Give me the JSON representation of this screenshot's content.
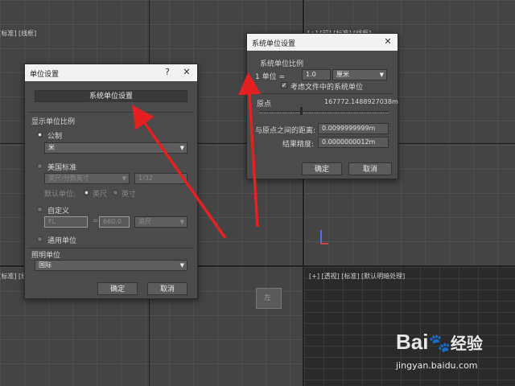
{
  "viewports": {
    "top_left_label": "[+] [顶] [标准] [线框]",
    "top_right_label": "[+] [前] [标准] [线框]",
    "bottom_left_label": "[+] [左] [标准] [线框]",
    "bottom_right_label": "[+] [透视] [标准] [默认明暗处理]"
  },
  "unit_setup": {
    "title": "单位设置",
    "help_glyph": "?",
    "close_glyph": "✕",
    "system_setup_button": "系统单位设置",
    "display_scale_label": "显示单位比例",
    "metric_label": "公制",
    "metric_value": "米",
    "us_standard_label": "美国标准",
    "us_standard_value": "英尺/分数英寸",
    "fraction_value": "1/32",
    "default_unit_label": "默认单位:",
    "feet_label": "英尺",
    "inch_label": "英寸",
    "custom_label": "自定义",
    "custom_name": "FL",
    "equals": "=",
    "custom_value": "660.0",
    "custom_unit": "英尺",
    "generic_label": "通用单位",
    "lighting_label": "照明单位",
    "lighting_value": "国际",
    "ok_label": "确定",
    "cancel_label": "取消"
  },
  "system_setup": {
    "title": "系统单位设置",
    "close_glyph": "✕",
    "group_label": "系统单位比例",
    "one_label": "1 单位 =",
    "unit_value": "1.0",
    "unit_select": "厘米",
    "respect_files_label": "考虑文件中的系统单位",
    "origin_label": "原点",
    "origin_value": "167772.1488927038m",
    "distance_label": "与原点之间的距离:",
    "distance_value": "0.0099999999m",
    "accuracy_label": "结果精度:",
    "accuracy_value": "0.0000000012m",
    "ok_label": "确定",
    "cancel_label": "取消"
  },
  "watermark": {
    "brand": "Bai",
    "brand_suffix": "经验",
    "url": "jingyan.baidu.com"
  },
  "colors": {
    "arrow": "#e52020",
    "dialog_bg": "#4b4b4b",
    "titlebar": "#f2f2f2"
  }
}
